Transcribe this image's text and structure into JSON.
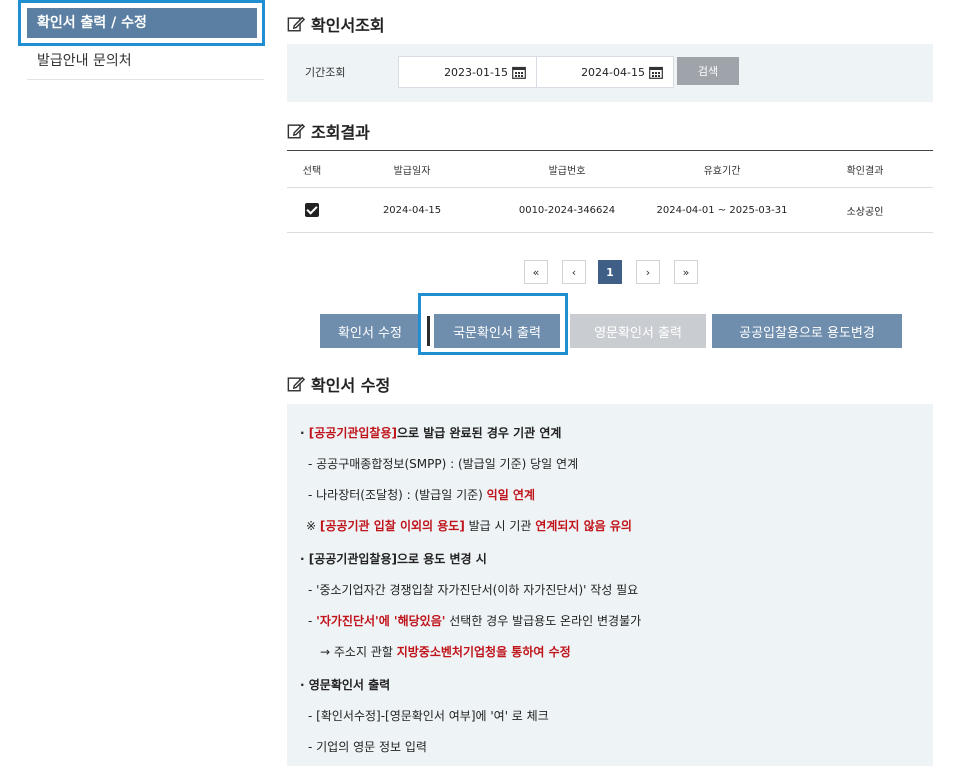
{
  "sidebar": {
    "active_label": "확인서 출력 / 수정",
    "items": [
      {
        "label": "발급안내 문의처"
      }
    ]
  },
  "search_section": {
    "title": "확인서조회",
    "period_label": "기간조회",
    "start_date": "2023-01-15",
    "end_date": "2024-04-15",
    "search_button": "검색"
  },
  "results_section": {
    "title": "조회결과",
    "columns": [
      "선택",
      "발급일자",
      "발급번호",
      "유효기간",
      "확인결과"
    ],
    "rows": [
      {
        "checked": true,
        "issue_date": "2024-04-15",
        "issue_no": "0010-2024-346624",
        "validity": "2024-04-01 ~ 2025-03-31",
        "result": "소상공인"
      }
    ]
  },
  "pagination": {
    "first": "«",
    "prev": "‹",
    "current": "1",
    "next": "›",
    "last": "»"
  },
  "actions": {
    "edit": "확인서 수정",
    "print_kr": "국문확인서 출력",
    "print_en": "영문확인서 출력",
    "change_purpose": "공공입찰용으로 용도변경"
  },
  "edit_section": {
    "title": "확인서 수정",
    "l1_bullet": "·",
    "l1_red": "[공공기관입찰용]",
    "l1_text": "으로 발급 완료된 경우 기관 연계",
    "l2": "- 공공구매종합정보(SMPP) : (발급일 기준) 당일 연계",
    "l3_text": "- 나라장터(조달청) : (발급일 기준) ",
    "l3_red": "익일 연계",
    "l4_mark": "※ ",
    "l4_red1": "[공공기관 입찰 이외의 용도]",
    "l4_text": " 발급 시 기관 ",
    "l4_red2": "연계되지 않음 유의",
    "l5": "· [공공기관입찰용]으로 용도 변경 시",
    "l6": "- '중소기업자간 경쟁입찰 자가진단서(이하 자가진단서)' 작성 필요",
    "l7_dash": "- ",
    "l7_red": "'자가진단서'에 '해당있음'",
    "l7_text": " 선택한 경우 발급용도 온라인 변경불가",
    "l8_text": "→ 주소지 관할 ",
    "l8_red": "지방중소벤처기업청을 통하여 수정",
    "l9": "· 영문확인서 출력",
    "l10": "- [확인서수정]-[영문확인서 여부]에 '여' 로 체크",
    "l11": "- 기업의 영문 정보 입력"
  }
}
